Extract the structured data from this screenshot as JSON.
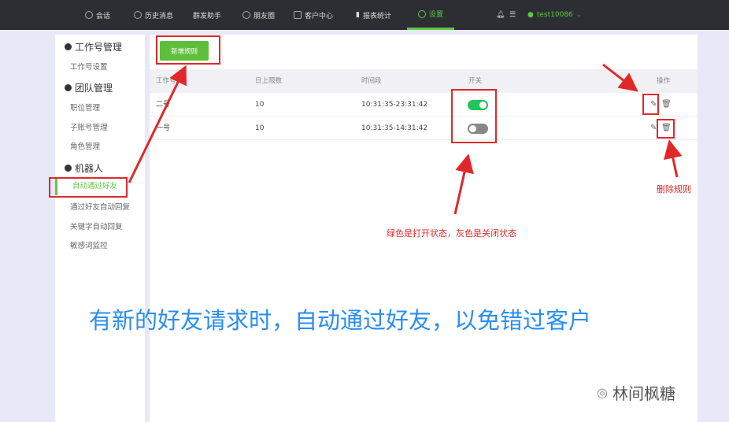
{
  "topnav": {
    "items": [
      {
        "label": "会话",
        "icon": "chat-icon"
      },
      {
        "label": "历史消息",
        "icon": "clock-icon"
      },
      {
        "label": "群发助手",
        "icon": ""
      },
      {
        "label": "朋友圈",
        "icon": "aperture-icon"
      },
      {
        "label": "客户中心",
        "icon": "user-icon"
      },
      {
        "label": "报表统计",
        "icon": "bar-chart-icon"
      },
      {
        "label": "设置",
        "icon": "gear-icon"
      }
    ],
    "active": "设置",
    "user": "test10086"
  },
  "sidebar": {
    "sections": [
      {
        "title": "工作号管理",
        "items": [
          "工作号设置"
        ]
      },
      {
        "title": "团队管理",
        "items": [
          "职位管理",
          "子账号管理",
          "角色管理"
        ]
      },
      {
        "title": "机器人",
        "items": [
          "自动通过好友",
          "通过好友自动回复",
          "关键字自动回复",
          "敏感词监控"
        ]
      }
    ],
    "active": "自动通过好友"
  },
  "main": {
    "add_button": "新增规则",
    "columns": [
      "工作号",
      "日上限数",
      "时间段",
      "开关",
      "操作"
    ],
    "rows": [
      {
        "account": "二号",
        "limit": "10",
        "period": "10:31:35-23:31:42",
        "enabled": true
      },
      {
        "account": "一号",
        "limit": "10",
        "period": "10:31:35-14:31:42",
        "enabled": false
      }
    ]
  },
  "annotations": {
    "switch_note": "绿色是打开状态，灰色是关闭状态",
    "delete_note": "删除规则",
    "caption": "有新的好友请求时，自动通过好友，以免错过客户",
    "watermark": "林间枫糖"
  },
  "colors": {
    "accent": "#5fc93f",
    "annotation": "#e0282a",
    "caption": "#2a8ef0"
  }
}
